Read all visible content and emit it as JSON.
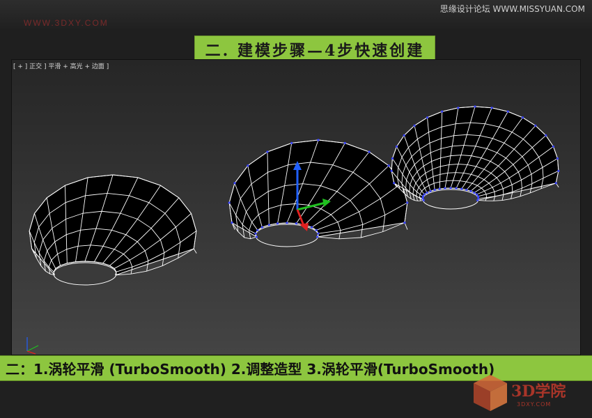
{
  "header": {
    "watermark_left": "WWW.3DXY.COM",
    "watermark_right": "思缘设计论坛 WWW.MISSYUAN.COM"
  },
  "title_banner": {
    "text": "二. 建模步骤—4步快速创建"
  },
  "viewport": {
    "label": "[ + ] 正交 ] 平滑 + 高光 + 边面 ]",
    "background": "#333333",
    "wire_color": "#ffffff",
    "vertex_color": "#3b46ff",
    "gizmo_colors": {
      "x": "#e02020",
      "y": "#20c020",
      "z": "#2060ff"
    }
  },
  "caption": {
    "text": "二：1.涡轮平滑 (TurboSmooth)  2.调整造型   3.涡轮平滑(TurboSmooth)"
  },
  "logo": {
    "text": "3D学院",
    "sub": "3DXY.COM",
    "accent": "#c0392b"
  }
}
